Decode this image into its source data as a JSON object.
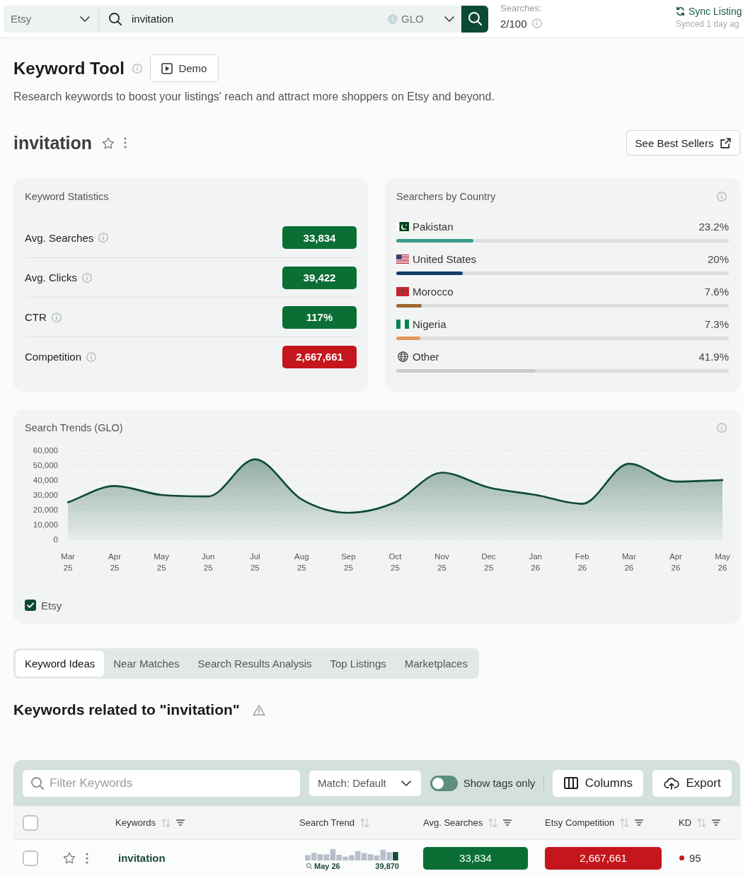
{
  "top_bar": {
    "marketplace": "Etsy",
    "search": {
      "value": "invitation"
    },
    "region": "GLO",
    "searches_label": "Searches:",
    "searches_count": "2/100",
    "sync": {
      "label": "Sync Listing",
      "status": "Synced 1 day ag"
    }
  },
  "header": {
    "title": "Keyword Tool",
    "demo_button": "Demo",
    "description": "Research keywords to boost your listings' reach and attract more shoppers on Etsy and beyond."
  },
  "keyword": {
    "text": "invitation",
    "starred": false,
    "best_sellers_button": "See Best Sellers"
  },
  "keyword_statistics": {
    "title": "Keyword Statistics",
    "rows": [
      {
        "label": "Avg. Searches",
        "value": "33,834",
        "color": "#0b6e35"
      },
      {
        "label": "Avg. Clicks",
        "value": "39,422",
        "color": "#0b6e35"
      },
      {
        "label": "CTR",
        "value": "117%",
        "color": "#0b6e35"
      },
      {
        "label": "Competition",
        "value": "2,667,661",
        "color": "#c4161c"
      }
    ]
  },
  "searchers_by_country": {
    "title": "Searchers by Country",
    "countries": [
      {
        "kind": "flag",
        "name": "Pakistan",
        "reading": "23.2%",
        "level": 0.232,
        "color": "#3a9c8c"
      },
      {
        "kind": "flag",
        "name": "United States",
        "reading": "20%",
        "level": 0.2,
        "color": "#123c69"
      },
      {
        "kind": "flag",
        "name": "Morocco",
        "reading": "7.6%",
        "level": 0.076,
        "color": "#9b6b2f"
      },
      {
        "kind": "flag",
        "name": "Nigeria",
        "reading": "7.3%",
        "level": 0.073,
        "color": "#e5965a"
      },
      {
        "kind": "other",
        "name": "Other",
        "reading": "41.9%",
        "level": 0.419,
        "color": "#c9cccb"
      }
    ]
  },
  "search_trends": {
    "legend_checked": true,
    "chart_data": {
      "type": "area",
      "title": "Search Trends (GLO)",
      "categories": [
        "Mar 25",
        "Apr 25",
        "May 25",
        "Jun 25",
        "Jul 25",
        "Aug 25",
        "Sep 25",
        "Oct 25",
        "Nov 25",
        "Dec 25",
        "Jan 26",
        "Feb 26",
        "Mar 26",
        "Apr 26",
        "May 26"
      ],
      "series": [
        {
          "name": "Etsy",
          "color": "#0d4a36",
          "values": [
            25000,
            36000,
            30000,
            29000,
            54000,
            27000,
            18000,
            25000,
            45000,
            35000,
            30000,
            24000,
            51000,
            39000,
            40000
          ]
        }
      ],
      "ylim": [
        0,
        60000
      ],
      "yticks": [
        0,
        {
          "value": 10000,
          "label": "10,000"
        },
        {
          "value": 20000,
          "label": "20,000"
        },
        {
          "value": 30000,
          "label": "30,000"
        },
        {
          "value": 40000,
          "label": "40,000"
        },
        {
          "value": 50000,
          "label": "50,000"
        },
        {
          "value": 60000,
          "label": "60,000"
        }
      ],
      "grid": true
    }
  },
  "tabs": [
    {
      "label": "Keyword Ideas",
      "selected": true
    },
    {
      "label": "Near Matches",
      "selected": false
    },
    {
      "label": "Search Results Analysis",
      "selected": false
    },
    {
      "label": "Top Listings",
      "selected": false
    },
    {
      "label": "Marketplaces",
      "selected": false
    }
  ],
  "related": {
    "title": "Keywords related to \"invitation\"",
    "filter": {
      "placeholder": "Filter Keywords"
    },
    "match": "Match: Default",
    "show_tags_only": {
      "label": "Show tags only",
      "on": false
    },
    "columns_button": "Columns",
    "export_button": "Export",
    "table": {
      "select_all_checked": false,
      "columns": [
        {
          "label": "Keywords",
          "filter": true
        },
        {
          "label": "Search Trend",
          "filter": false
        },
        {
          "label": "Avg. Searches",
          "filter": true
        },
        {
          "label": "Etsy Competition",
          "filter": true
        },
        {
          "label": "KD",
          "filter": true
        }
      ],
      "rows": [
        {
          "checked": false,
          "starred": false,
          "keyword": "invitation",
          "trend_period": "May 26",
          "trend_value": "39,870",
          "avg_searches": {
            "value": "33,834",
            "color": "#0b6e35"
          },
          "competition": {
            "value": "2,667,661",
            "color": "#c4161c"
          },
          "kd": {
            "value": "95",
            "color": "#c4161c"
          }
        }
      ]
    }
  }
}
